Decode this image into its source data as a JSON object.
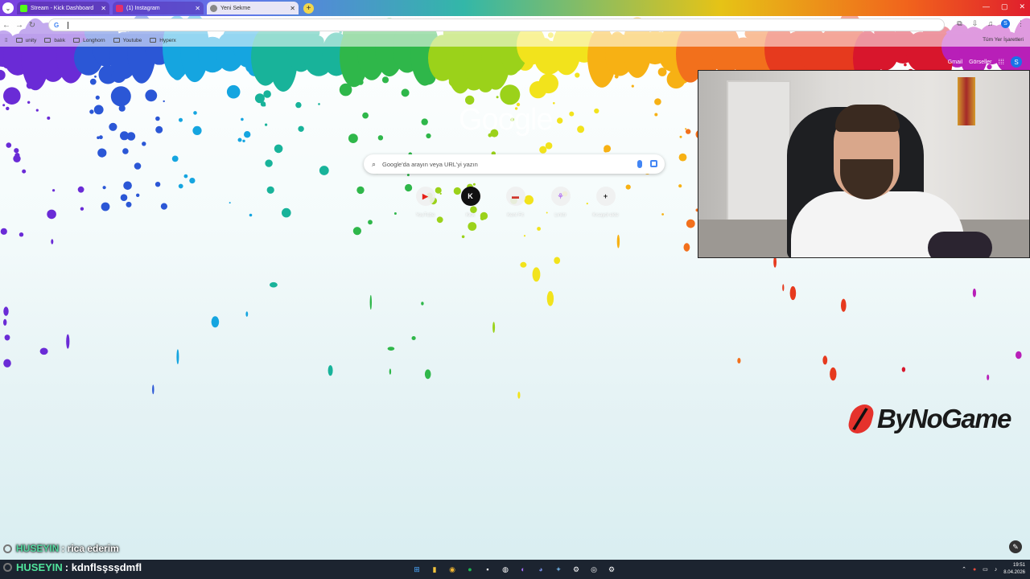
{
  "browser": {
    "tabs": [
      {
        "title": "Stream - Kick Dashboard",
        "favicon_color": "#53fc18"
      },
      {
        "title": "(1) Instagram",
        "favicon_color": "#e1306c"
      },
      {
        "title": "Yeni Sekme",
        "favicon_color": "#888888"
      }
    ],
    "bookmarks": [
      "unity",
      "balık",
      "Longhorn",
      "Youtube",
      "Hyperx"
    ],
    "all_bookmarks": "Tüm Yer İşaretleri",
    "profile_initial": "S"
  },
  "ntp": {
    "top_links": [
      "Gmail",
      "Görseller"
    ],
    "logo": "Google",
    "search_placeholder": "Google'da arayın veya URL'yi yazın",
    "shortcuts": [
      {
        "label": "YouTube",
        "glyph": "▶",
        "color": "#e62117"
      },
      {
        "label": "Kick",
        "glyph": "K",
        "color": "#53fc18"
      },
      {
        "label": "Kent Fit",
        "glyph": "▬",
        "color": "#d0342c"
      },
      {
        "label": "Linktr",
        "glyph": "⚘",
        "color": "#b77cf0"
      },
      {
        "label": "Kısayol ekle",
        "glyph": "+",
        "color": "#333333"
      }
    ],
    "avatar_initial": "S"
  },
  "sponsor": {
    "name": "ByNoGame"
  },
  "chat": [
    {
      "user": "HUSEYIN",
      "message": ": rica ederim"
    },
    {
      "user": "HUSEYIN",
      "message": ": kdnflsşsşdmfl"
    }
  ],
  "taskbar": {
    "time": "19:51",
    "date": "8.04.2026"
  }
}
